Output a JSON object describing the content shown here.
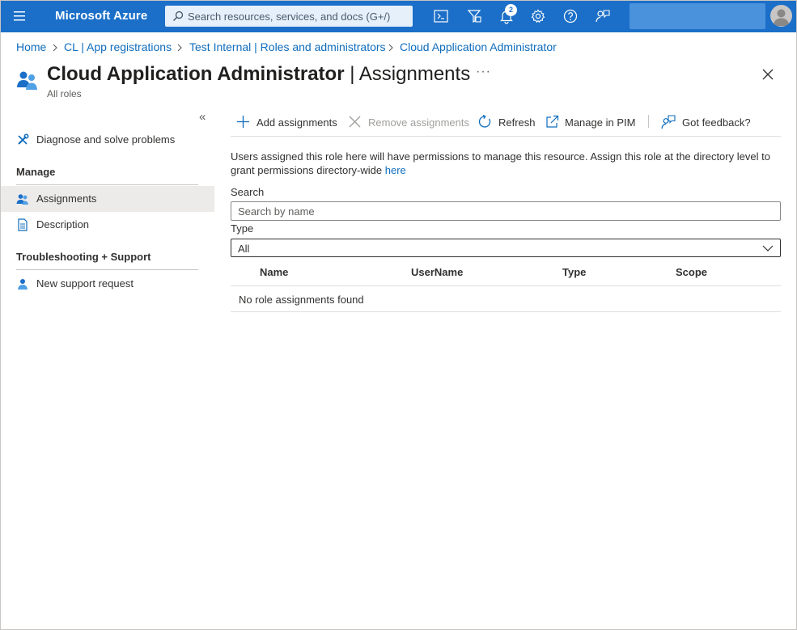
{
  "topbar": {
    "brand": "Microsoft Azure",
    "search_placeholder": "Search resources, services, and docs (G+/)",
    "notifications_count": "2",
    "accent": "#1b6fc8",
    "icons": [
      "hamburger-menu-icon",
      "cloud-shell-icon",
      "directory-filter-icon",
      "notifications-bell-icon",
      "settings-gear-icon",
      "help-icon",
      "feedback-icon",
      "avatar-icon"
    ]
  },
  "breadcrumb": [
    "Home",
    "CL | App registrations",
    "Test Internal | Roles and administrators",
    "Cloud Application Administrator"
  ],
  "page": {
    "title_main": "Cloud Application Administrator",
    "title_sep": " | ",
    "title_section": "Assignments",
    "subtitle": "All roles",
    "more": "···"
  },
  "sidebar": {
    "collapse": "«",
    "items": [
      {
        "label": "Diagnose and solve problems",
        "icon": "wrench-tools-icon"
      }
    ],
    "sections": [
      {
        "heading": "Manage",
        "items": [
          {
            "label": "Assignments",
            "icon": "users-icon",
            "active": true
          },
          {
            "label": "Description",
            "icon": "document-icon"
          }
        ]
      },
      {
        "heading": "Troubleshooting + Support",
        "items": [
          {
            "label": "New support request",
            "icon": "support-person-icon"
          }
        ]
      }
    ]
  },
  "toolbar": {
    "add": "Add assignments",
    "remove": "Remove assignments",
    "refresh": "Refresh",
    "manage_pim": "Manage in PIM",
    "feedback": "Got feedback?"
  },
  "content": {
    "description": "Users assigned this role here will have permissions to manage this resource. Assign this role at the directory level to grant permissions directory-wide",
    "description_link": "here",
    "search_label": "Search",
    "search_placeholder": "Search by name",
    "type_label": "Type",
    "type_value": "All",
    "table": {
      "columns": [
        "Name",
        "UserName",
        "Type",
        "Scope"
      ],
      "empty_message": "No role assignments found"
    }
  }
}
